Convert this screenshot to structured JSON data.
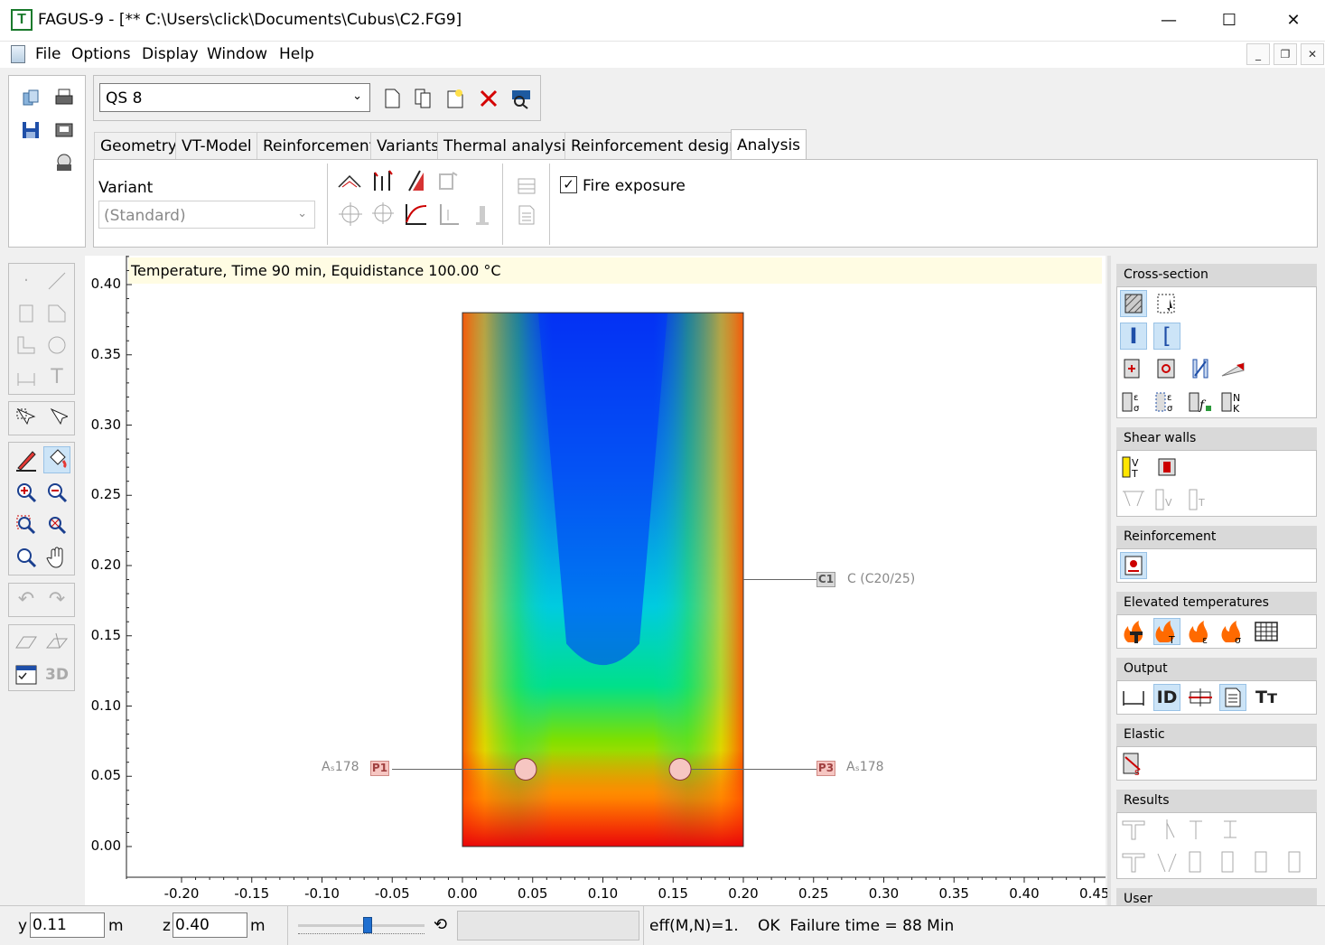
{
  "window": {
    "title": "FAGUS-9 - [** C:\\Users\\click\\Documents\\Cubus\\C2.FG9]",
    "app_icon_letter": "T",
    "min": "—",
    "max": "☐",
    "close": "✕"
  },
  "menu": {
    "items": [
      "File",
      "Options",
      "Display",
      "Window",
      "Help"
    ],
    "mdi_min": "_",
    "mdi_restore": "❐",
    "mdi_close": "✕"
  },
  "section_select": {
    "value": "QS 8"
  },
  "tabs": [
    "Geometry",
    "VT-Model",
    "Reinforcement",
    "Variants",
    "Thermal analysis",
    "Reinforcement design",
    "Analysis"
  ],
  "active_tab": "Analysis",
  "variant": {
    "label": "Variant",
    "value": "(Standard)"
  },
  "fire_exposure": {
    "label": "Fire exposure",
    "checked": true
  },
  "plot": {
    "banner": "Temperature, Time 90 min, Equidistance 100.00 °C",
    "y_ticks": [
      "0.40",
      "0.35",
      "0.30",
      "0.25",
      "0.20",
      "0.15",
      "0.10",
      "0.05",
      "0.00"
    ],
    "x_ticks": [
      "-0.20",
      "-0.15",
      "-0.10",
      "-0.05",
      "0.00",
      "0.05",
      "0.10",
      "0.15",
      "0.20",
      "0.25",
      "0.30",
      "0.35",
      "0.40",
      "0.45"
    ],
    "concrete": {
      "tag": "C1",
      "label": "C (C20/25)"
    },
    "bars": [
      {
        "tag": "P1",
        "label": "Aₛ178",
        "y": 0.055,
        "z": 0.045
      },
      {
        "tag": "P3",
        "label": "Aₛ178",
        "y": 0.055,
        "z": 0.155
      }
    ],
    "section": {
      "width": 0.2,
      "height": 0.38
    },
    "colors": {
      "cold": "#0033ff",
      "hot": "#e8000a"
    }
  },
  "sidebar": {
    "cross_section": "Cross-section",
    "shear_walls": "Shear walls",
    "reinforcement": "Reinforcement",
    "elevated": "Elevated temperatures",
    "output": "Output",
    "elastic": "Elastic",
    "results": "Results",
    "user": "User",
    "output_id": "ID",
    "output_tt": "Tт"
  },
  "status": {
    "y_label": "y",
    "y_value": "0.11",
    "y_unit": "m",
    "z_label": "z",
    "z_value": "0.40",
    "z_unit": "m",
    "eff": "eff(M,N)=1.",
    "result": "OK  Failure time = 88 Min",
    "slider": 0.55
  },
  "left_toolbar": {
    "text_tool": "T",
    "threed": "3D"
  }
}
